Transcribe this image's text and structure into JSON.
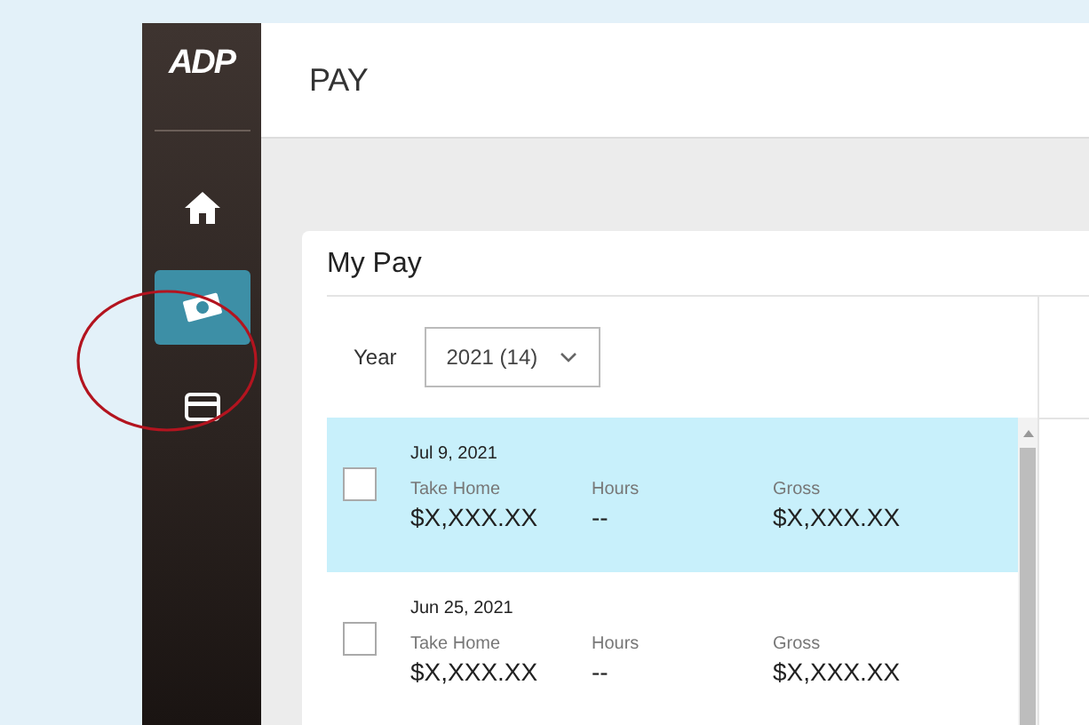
{
  "logo": "ADP",
  "header": {
    "title": "PAY"
  },
  "sidebar": {
    "items": [
      {
        "kind": "home",
        "selected": false
      },
      {
        "kind": "money",
        "selected": true
      },
      {
        "kind": "card",
        "selected": false
      }
    ]
  },
  "card": {
    "title": "My Pay",
    "year": {
      "label": "Year",
      "value": "2021 (14)"
    },
    "rows": [
      {
        "date": "Jul 9, 2021",
        "selected": true,
        "checked": false,
        "take_home_label": "Take Home",
        "take_home": "$X,XXX.XX",
        "hours_label": "Hours",
        "hours": "--",
        "gross_label": "Gross",
        "gross": "$X,XXX.XX"
      },
      {
        "date": "Jun 25, 2021",
        "selected": false,
        "checked": false,
        "take_home_label": "Take Home",
        "take_home": "$X,XXX.XX",
        "hours_label": "Hours",
        "hours": "--",
        "gross_label": "Gross",
        "gross": "$X,XXX.XX"
      }
    ]
  }
}
